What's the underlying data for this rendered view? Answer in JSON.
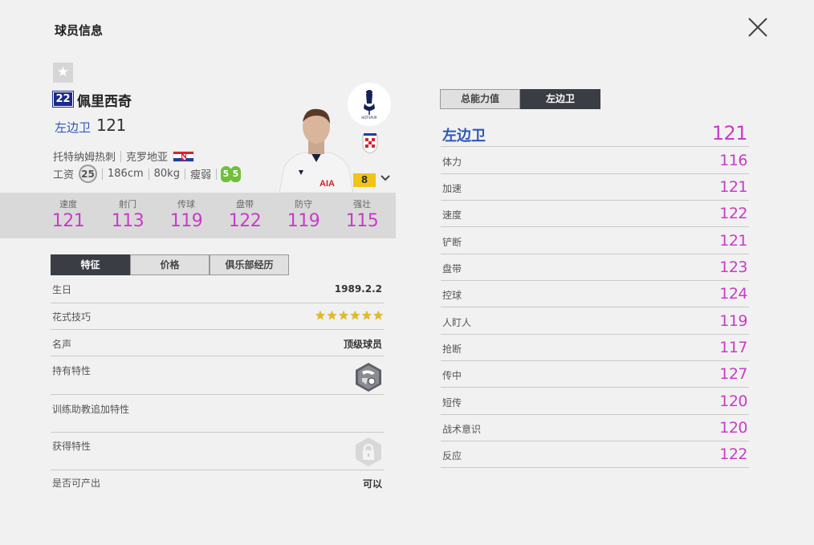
{
  "header": {
    "title": "球员信息"
  },
  "player": {
    "number": "22",
    "name": "佩里西奇",
    "position": "左边卫",
    "position_rating": "121",
    "club": "托特纳姆热刺",
    "nation": "克罗地亚",
    "wage_label": "工资",
    "wage": "25",
    "height": "186cm",
    "weight": "80kg",
    "body_type": "瘦弱",
    "weak_foot_left": "5",
    "weak_foot_right": "5",
    "enhance_level": "8"
  },
  "stats": [
    {
      "label": "速度",
      "value": "121"
    },
    {
      "label": "射门",
      "value": "113"
    },
    {
      "label": "传球",
      "value": "119"
    },
    {
      "label": "盘带",
      "value": "122"
    },
    {
      "label": "防守",
      "value": "119"
    },
    {
      "label": "强壮",
      "value": "115"
    }
  ],
  "left_tabs": [
    "特征",
    "价格",
    "俱乐部经历"
  ],
  "info": {
    "birthday_label": "生日",
    "birthday": "1989.2.2",
    "skill_label": "花式技巧",
    "skill_stars": 6,
    "reputation_label": "名声",
    "reputation": "顶级球员",
    "traits_label": "持有特性",
    "coach_traits_label": "训练助教追加特性",
    "acquired_traits_label": "获得特性",
    "producible_label": "是否可产出",
    "producible": "可以"
  },
  "right_tabs": [
    "总能力值",
    "左边卫"
  ],
  "position_summary": {
    "label": "左边卫",
    "value": "121"
  },
  "attributes": [
    {
      "label": "体力",
      "value": "116"
    },
    {
      "label": "加速",
      "value": "121"
    },
    {
      "label": "速度",
      "value": "122"
    },
    {
      "label": "铲断",
      "value": "121"
    },
    {
      "label": "盘带",
      "value": "123"
    },
    {
      "label": "控球",
      "value": "124"
    },
    {
      "label": "人盯人",
      "value": "119"
    },
    {
      "label": "抢断",
      "value": "117"
    },
    {
      "label": "传中",
      "value": "127"
    },
    {
      "label": "短传",
      "value": "120"
    },
    {
      "label": "战术意识",
      "value": "120"
    },
    {
      "label": "反应",
      "value": "122"
    }
  ],
  "colors": {
    "accent_magenta": "#c83cc8",
    "accent_blue": "#2f57b8",
    "tab_active": "#3a3d44"
  }
}
